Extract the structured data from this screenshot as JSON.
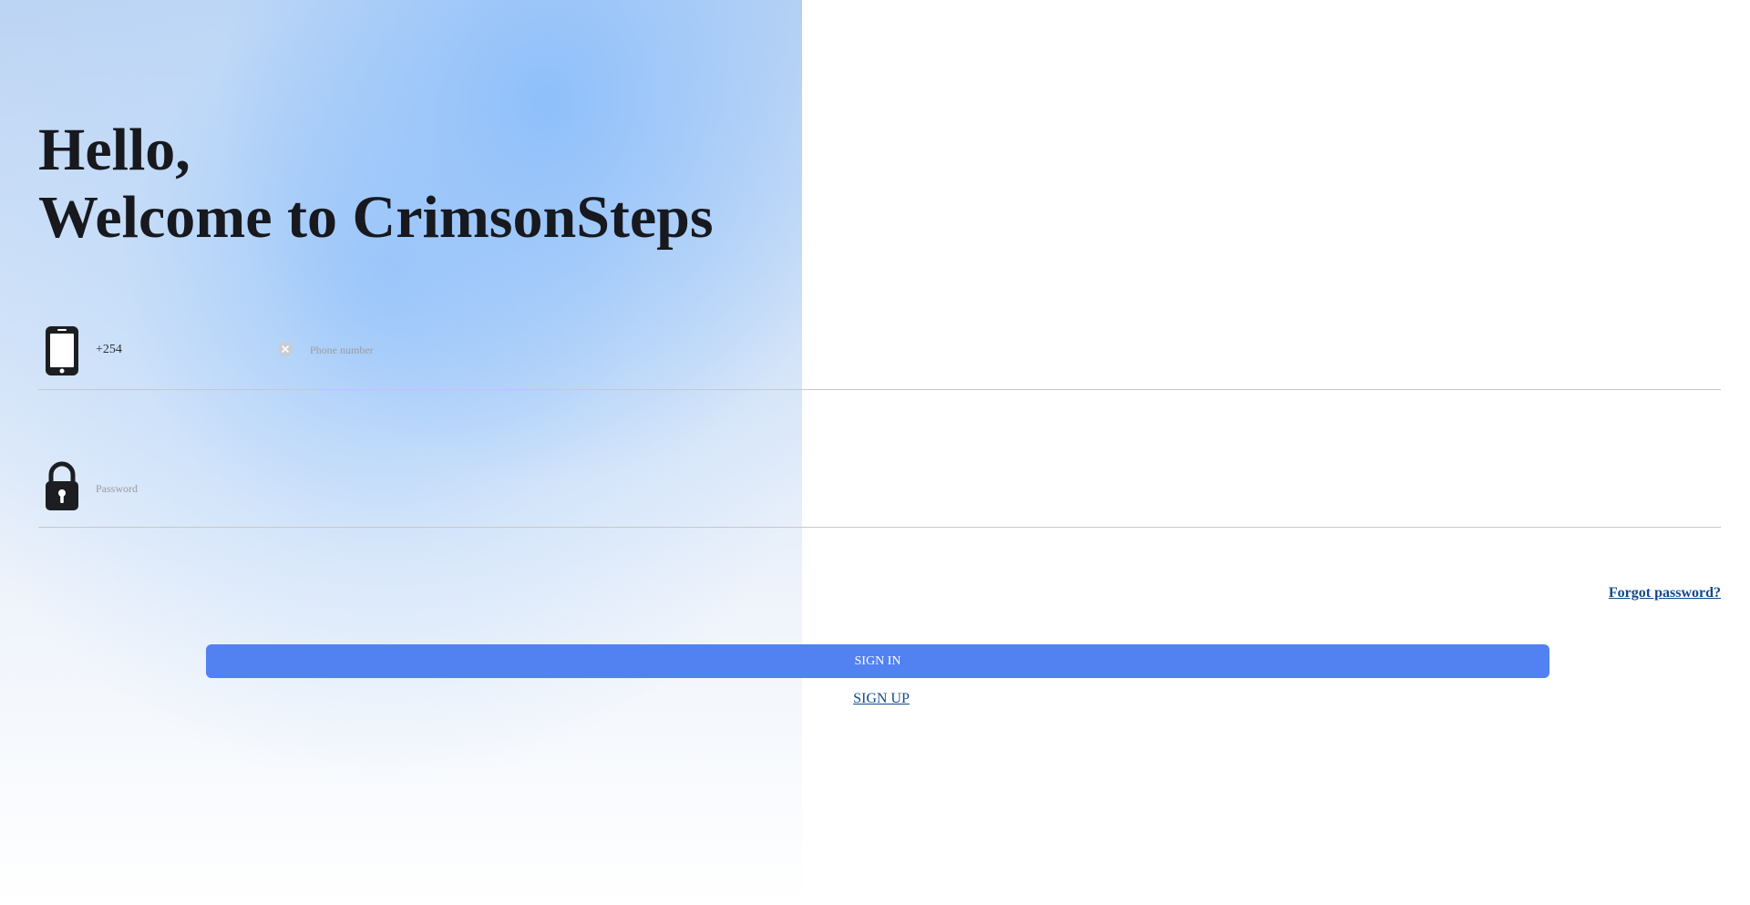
{
  "heading": {
    "line1": "Hello,",
    "line2": "Welcome to CrimsonSteps"
  },
  "phone_field": {
    "icon": "phone-icon",
    "country_code": "+254",
    "clear_icon": "clear-icon",
    "placeholder": "Phone number",
    "value": ""
  },
  "password_field": {
    "icon": "lock-icon",
    "placeholder": "Password",
    "value": ""
  },
  "links": {
    "forgot_password": "Forgot password?",
    "sign_up": "SIGN UP"
  },
  "buttons": {
    "sign_in": "SIGN IN"
  },
  "colors": {
    "primary_button": "#5282f2",
    "link": "#0f4a8a",
    "heading": "#17191e",
    "background_gradient": "#9cc5fa"
  }
}
